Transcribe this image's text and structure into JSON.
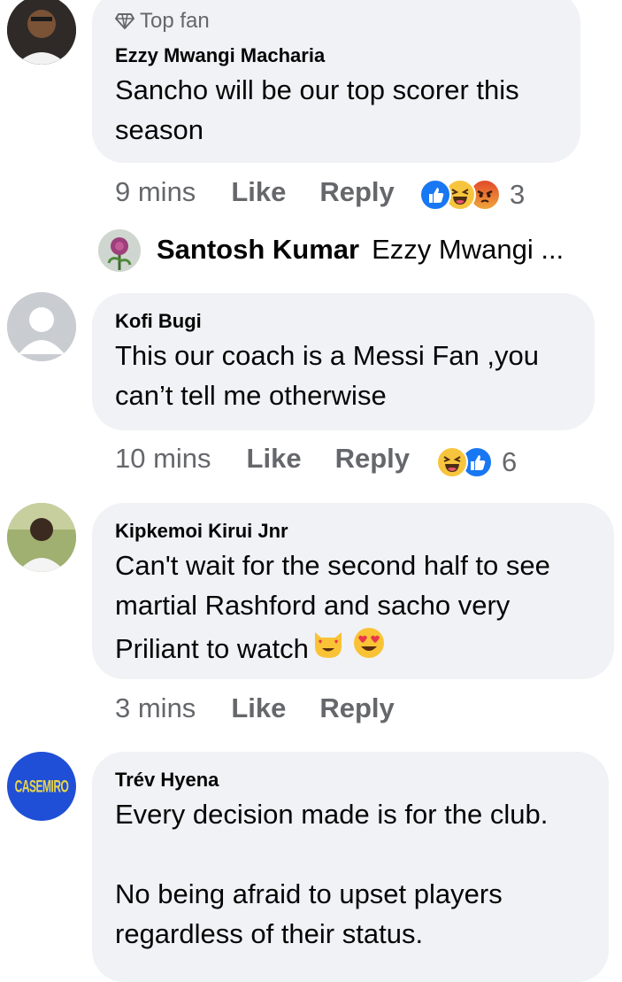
{
  "comments": [
    {
      "badge": "Top fan",
      "author": "Ezzy Mwangi Macharia",
      "text": "Sancho will be our top scorer this\nseason",
      "time": "9 mins",
      "like": "Like",
      "reply": "Reply",
      "reaction_icons": [
        "like-icon",
        "haha-icon",
        "angry-icon"
      ],
      "reaction_count": "3"
    },
    {
      "author": "Kofi Bugi",
      "text": "This our coach is a Messi Fan ,you\ncan’t tell me otherwise",
      "time": "10 mins",
      "like": "Like",
      "reply": "Reply",
      "reaction_icons": [
        "haha-icon",
        "like-icon"
      ],
      "reaction_count": "6"
    },
    {
      "author": "Kipkemoi Kirui Jnr",
      "text_lines": [
        "Can't wait for the second half to see",
        "martial Rashford and sacho very",
        "Priliant to watch"
      ],
      "text_emojis": [
        "heart-eyes-cat-emoji",
        "heart-eyes-emoji"
      ],
      "time": "3 mins",
      "like": "Like",
      "reply": "Reply"
    },
    {
      "author": "Trév Hyena",
      "text": "Every decision made is for the club.\n\nNo being afraid to upset players\nregardless of their status.",
      "avatar_text": "CASEMIRO"
    }
  ],
  "reply_preview": {
    "author": "Santosh Kumar",
    "snippet": "Ezzy Mwangi ..."
  },
  "colors": {
    "bubble": "#f0f2f5",
    "meta": "#65676b",
    "like_blue": "#1877f2",
    "text": "#050505"
  }
}
